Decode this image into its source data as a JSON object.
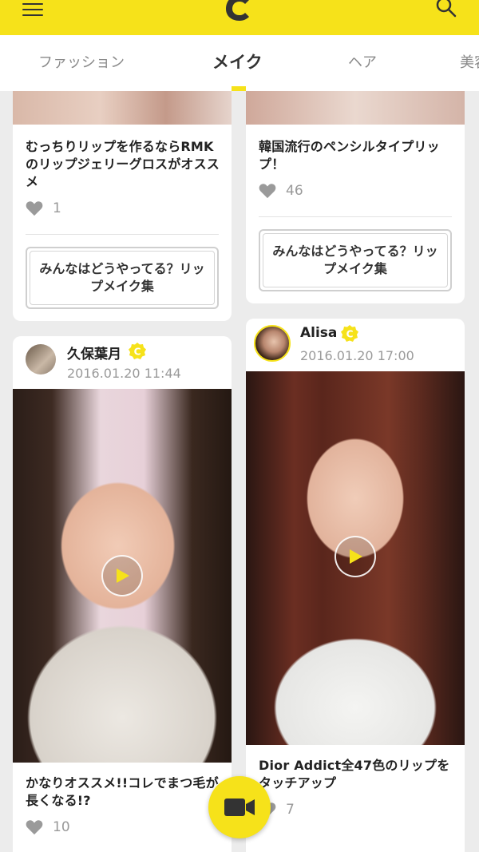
{
  "tabs": [
    {
      "label": "ファッション",
      "active": false
    },
    {
      "label": "メイク",
      "active": true
    },
    {
      "label": "ヘア",
      "active": false
    },
    {
      "label": "美容",
      "active": false
    }
  ],
  "accent_color": "#f6e21a",
  "cards": [
    {
      "title": "むっちりリップを作るならRMKのリップジェリーグロスがオススメ",
      "likes": "1",
      "related": "みんなはどうやってる？リップメイク集"
    },
    {
      "title": "韓国流行のペンシルタイプリップ！",
      "likes": "46",
      "related": "みんなはどうやってる？リップメイク集"
    },
    {
      "author": "久保葉月",
      "date": "2016.01.20 11:44",
      "title": "かなりオススメ!!コレでまつ毛が長くなる!?",
      "likes": "10"
    },
    {
      "author": "Alisa",
      "date": "2016.01.20 17:00",
      "title": "Dior Addict全47色のリップをタッチアップ",
      "likes": "7"
    }
  ],
  "icons": [
    "menu-icon",
    "logo-icon",
    "search-icon",
    "heart-icon",
    "curator-badge-icon",
    "play-icon",
    "video-camera-icon"
  ]
}
